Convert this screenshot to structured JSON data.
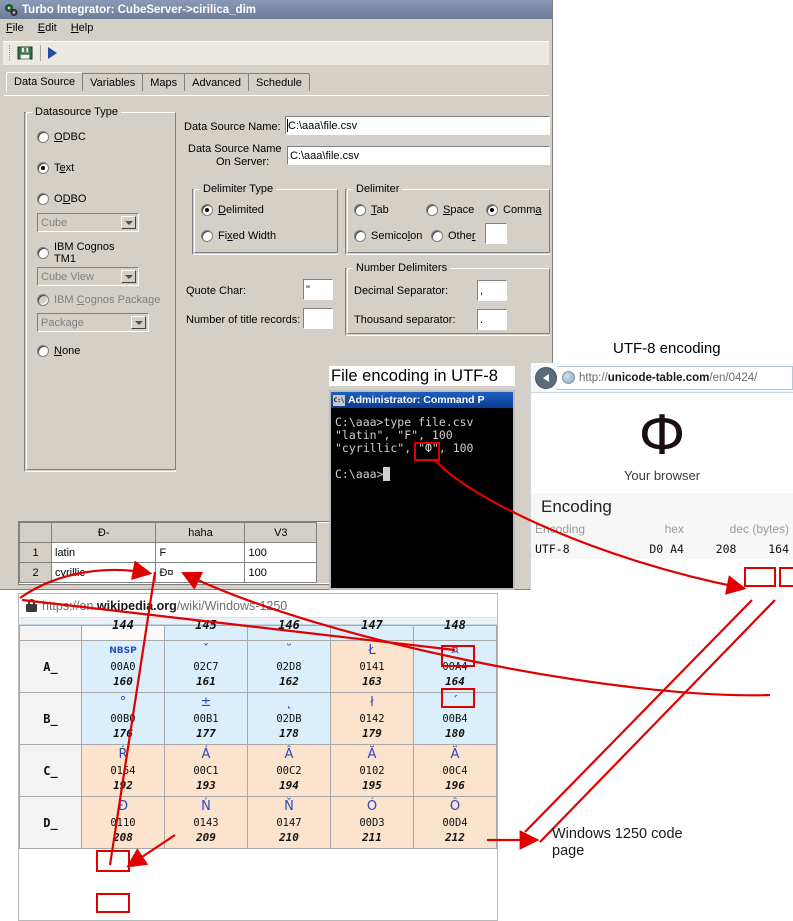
{
  "ti_window": {
    "title": "Turbo Integrator: CubeServer->cirilica_dim",
    "title_icon": "gears-icon",
    "menu": [
      {
        "label": "File",
        "accel": "F"
      },
      {
        "label": "Edit",
        "accel": "E"
      },
      {
        "label": "Help",
        "accel": "H"
      }
    ],
    "toolbar": {
      "save_icon": "save-floppy-icon",
      "run_icon": "run-play-icon"
    },
    "tabs": [
      {
        "label": "Data Source",
        "active": true
      },
      {
        "label": "Variables",
        "active": false
      },
      {
        "label": "Maps",
        "active": false
      },
      {
        "label": "Advanced",
        "active": false
      },
      {
        "label": "Schedule",
        "active": false
      }
    ],
    "datasource_type": {
      "legend": "Datasource Type",
      "options": [
        {
          "label": "ODBC",
          "selected": false,
          "disabled": false
        },
        {
          "label": "Text",
          "selected": true,
          "disabled": false
        },
        {
          "label": "ODBO",
          "selected": false,
          "disabled": false
        },
        {
          "label": "IBM Cognos TM1",
          "selected": false,
          "disabled": false
        },
        {
          "label": "IBM Cognos Package",
          "selected": false,
          "disabled": true
        },
        {
          "label": "None",
          "selected": false,
          "disabled": false
        }
      ],
      "combo_cube": "Cube",
      "combo_cube_view": "Cube View",
      "combo_package": "Package"
    },
    "fields": {
      "data_source_name_label": "Data Source Name:",
      "data_source_name_value": "C:\\aaa\\file.csv",
      "data_source_name_server_label_1": "Data Source Name",
      "data_source_name_server_label_2": "On Server:",
      "data_source_name_server_value": "C:\\aaa\\file.csv",
      "quote_char_label": "Quote Char:",
      "quote_char_value": "\"",
      "title_records_label": "Number of title records:",
      "title_records_value": ""
    },
    "delimiter_type": {
      "legend": "Delimiter Type",
      "options": [
        {
          "label": "Delimited",
          "selected": true
        },
        {
          "label": "Fixed Width",
          "selected": false
        }
      ]
    },
    "delimiter": {
      "legend": "Delimiter",
      "options": [
        {
          "label": "Tab",
          "selected": false
        },
        {
          "label": "Space",
          "selected": false
        },
        {
          "label": "Comma",
          "selected": true
        },
        {
          "label": "Semicolon",
          "selected": false
        },
        {
          "label": "Other",
          "selected": false
        }
      ],
      "other_value": ""
    },
    "number_delimiters": {
      "legend": "Number Delimiters",
      "decimal_label": "Decimal Separator:",
      "decimal_value": ",",
      "thousand_label": "Thousand separator:",
      "thousand_value": "."
    }
  },
  "preview_grid": {
    "columns": [
      "",
      "Đ-",
      "haha",
      "V3"
    ],
    "rows": [
      {
        "n": "1",
        "c1": "latin",
        "c2": "F",
        "c3": "100"
      },
      {
        "n": "2",
        "c1": "cyrillic",
        "c2": "Đ¤",
        "c3": "100"
      }
    ]
  },
  "console": {
    "caption": "File encoding in UTF-8",
    "window_title": "Administrator: Command P",
    "title_icon": "console-icon",
    "lines": [
      "C:\\aaa>type file.csv",
      "\"latin\", \"F\", 100",
      "\"cyrillic\", \"Ф\", 100",
      "",
      "C:\\aaa>"
    ],
    "cursor": "_"
  },
  "browser_unicode_table": {
    "caption": "UTF-8 encoding",
    "back_icon": "back-arrow-icon",
    "favicon": "globe-icon",
    "url_prefix": "http://",
    "url_domain": "unicode-table.com",
    "url_path": "/en/0424/",
    "hero_glyph": "Ф",
    "hero_caption": "Your browser",
    "section_title": "Encoding",
    "columns": [
      "Encoding",
      "hex",
      "dec (bytes)"
    ],
    "rows": [
      {
        "encoding": "UTF-8",
        "hex": "D0 A4",
        "dec1": "208",
        "dec2": "164"
      }
    ]
  },
  "browser_wikipedia": {
    "lock_icon": "lock-icon",
    "url_prefix": "https://en.",
    "url_domain": "wikipedia.org",
    "url_path": "/wiki/Windows-1250",
    "cut_row_numbers": [
      "144",
      "145",
      "146",
      "147",
      "148"
    ],
    "rows": [
      {
        "header": "A_",
        "cells": [
          {
            "glyph": "NBSP",
            "hex": "00A0",
            "dec": "160",
            "bg": "bg-blue",
            "nbsp": true
          },
          {
            "glyph": "ˇ",
            "hex": "02C7",
            "dec": "161",
            "bg": "bg-blue"
          },
          {
            "glyph": "˘",
            "hex": "02D8",
            "dec": "162",
            "bg": "bg-blue"
          },
          {
            "glyph": "Ł",
            "hex": "0141",
            "dec": "163",
            "bg": "bg-peach"
          },
          {
            "glyph": "¤",
            "hex": "00A4",
            "dec": "164",
            "bg": "bg-blue",
            "highlight": true
          }
        ]
      },
      {
        "header": "B_",
        "cells": [
          {
            "glyph": "°",
            "hex": "00B0",
            "dec": "176",
            "bg": "bg-blue"
          },
          {
            "glyph": "±",
            "hex": "00B1",
            "dec": "177",
            "bg": "bg-blue"
          },
          {
            "glyph": "˛",
            "hex": "02DB",
            "dec": "178",
            "bg": "bg-blue"
          },
          {
            "glyph": "ł",
            "hex": "0142",
            "dec": "179",
            "bg": "bg-peach"
          },
          {
            "glyph": "´",
            "hex": "00B4",
            "dec": "180",
            "bg": "bg-blue"
          }
        ]
      },
      {
        "header": "C_",
        "cells": [
          {
            "glyph": "Ŕ",
            "hex": "0154",
            "dec": "192",
            "bg": "bg-peach"
          },
          {
            "glyph": "Á",
            "hex": "00C1",
            "dec": "193",
            "bg": "bg-peach"
          },
          {
            "glyph": "Â",
            "hex": "00C2",
            "dec": "194",
            "bg": "bg-peach"
          },
          {
            "glyph": "Ă",
            "hex": "0102",
            "dec": "195",
            "bg": "bg-peach"
          },
          {
            "glyph": "Ä",
            "hex": "00C4",
            "dec": "196",
            "bg": "bg-peach"
          }
        ]
      },
      {
        "header": "D_",
        "cells": [
          {
            "glyph": "Đ",
            "hex": "0110",
            "dec": "208",
            "bg": "bg-peach",
            "highlight": true,
            "highlight_dec": true
          },
          {
            "glyph": "Ń",
            "hex": "0143",
            "dec": "209",
            "bg": "bg-peach"
          },
          {
            "glyph": "Ň",
            "hex": "0147",
            "dec": "210",
            "bg": "bg-peach"
          },
          {
            "glyph": "Ó",
            "hex": "00D3",
            "dec": "211",
            "bg": "bg-peach"
          },
          {
            "glyph": "Ô",
            "hex": "00D4",
            "dec": "212",
            "bg": "bg-peach"
          }
        ]
      }
    ]
  },
  "annotations": {
    "windows_1250_note_line1": "Windows 1250 code",
    "windows_1250_note_line2": "page",
    "accent_color": "#e00000"
  }
}
